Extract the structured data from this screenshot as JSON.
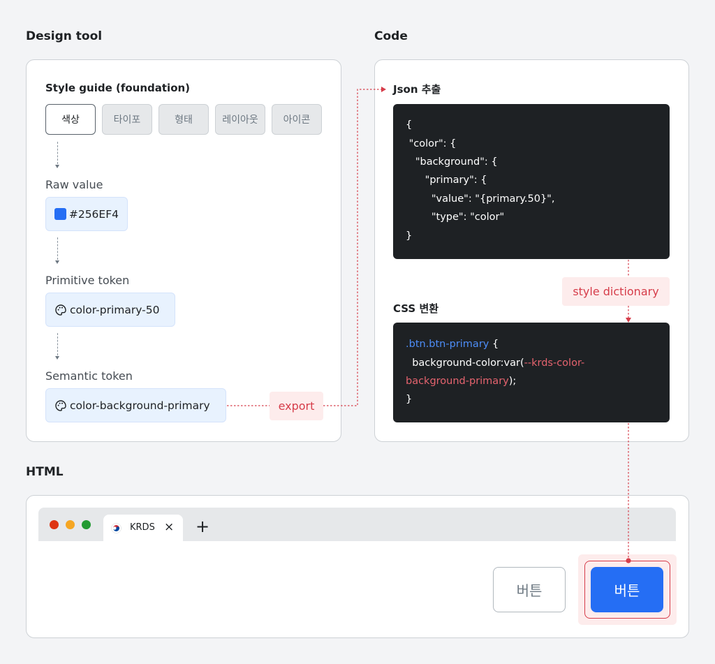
{
  "sections": {
    "design_tool": "Design tool",
    "code": "Code",
    "html": "HTML"
  },
  "design": {
    "style_guide_title": "Style guide (foundation)",
    "tabs": [
      "색상",
      "타이포",
      "형태",
      "레이아웃",
      "아이콘"
    ],
    "active_tab": "색상",
    "raw_value_label": "Raw value",
    "raw_value": "#256EF4",
    "raw_value_color": "#256EF4",
    "primitive_label": "Primitive token",
    "primitive_value": "color-primary-50",
    "semantic_label": "Semantic token",
    "semantic_value": "color-background-primary"
  },
  "connectors": {
    "export": "export",
    "style_dictionary": "style dictionary"
  },
  "code": {
    "json_title": "Json 추출",
    "json_lines": [
      "{",
      " \"color\": {",
      "   \"background\": {",
      "      \"primary\": {",
      "        \"value\": \"{primary.50}\",",
      "        \"type\": \"color\"",
      "}"
    ],
    "css_title": "CSS 변환",
    "css_selector": ".btn.btn-primary",
    "css_open": " {",
    "css_prop": "  background-color:var(",
    "css_var_1": "--krds-color-",
    "css_var_2": "background-primary",
    "css_close_paren": ");",
    "css_close": "}"
  },
  "browser": {
    "tab_title": "KRDS",
    "close_glyph": "×",
    "new_tab_glyph": "+",
    "secondary_button": "버튼",
    "primary_button": "버튼"
  },
  "colors": {
    "primary": "#256EF4",
    "connector_red": "#D63D4A",
    "code_bg": "#1E2124",
    "code_blue": "#4D8DF8",
    "code_red": "#E5636E"
  },
  "icons": {
    "palette": "palette-icon",
    "flag": "korea-flag-icon"
  }
}
